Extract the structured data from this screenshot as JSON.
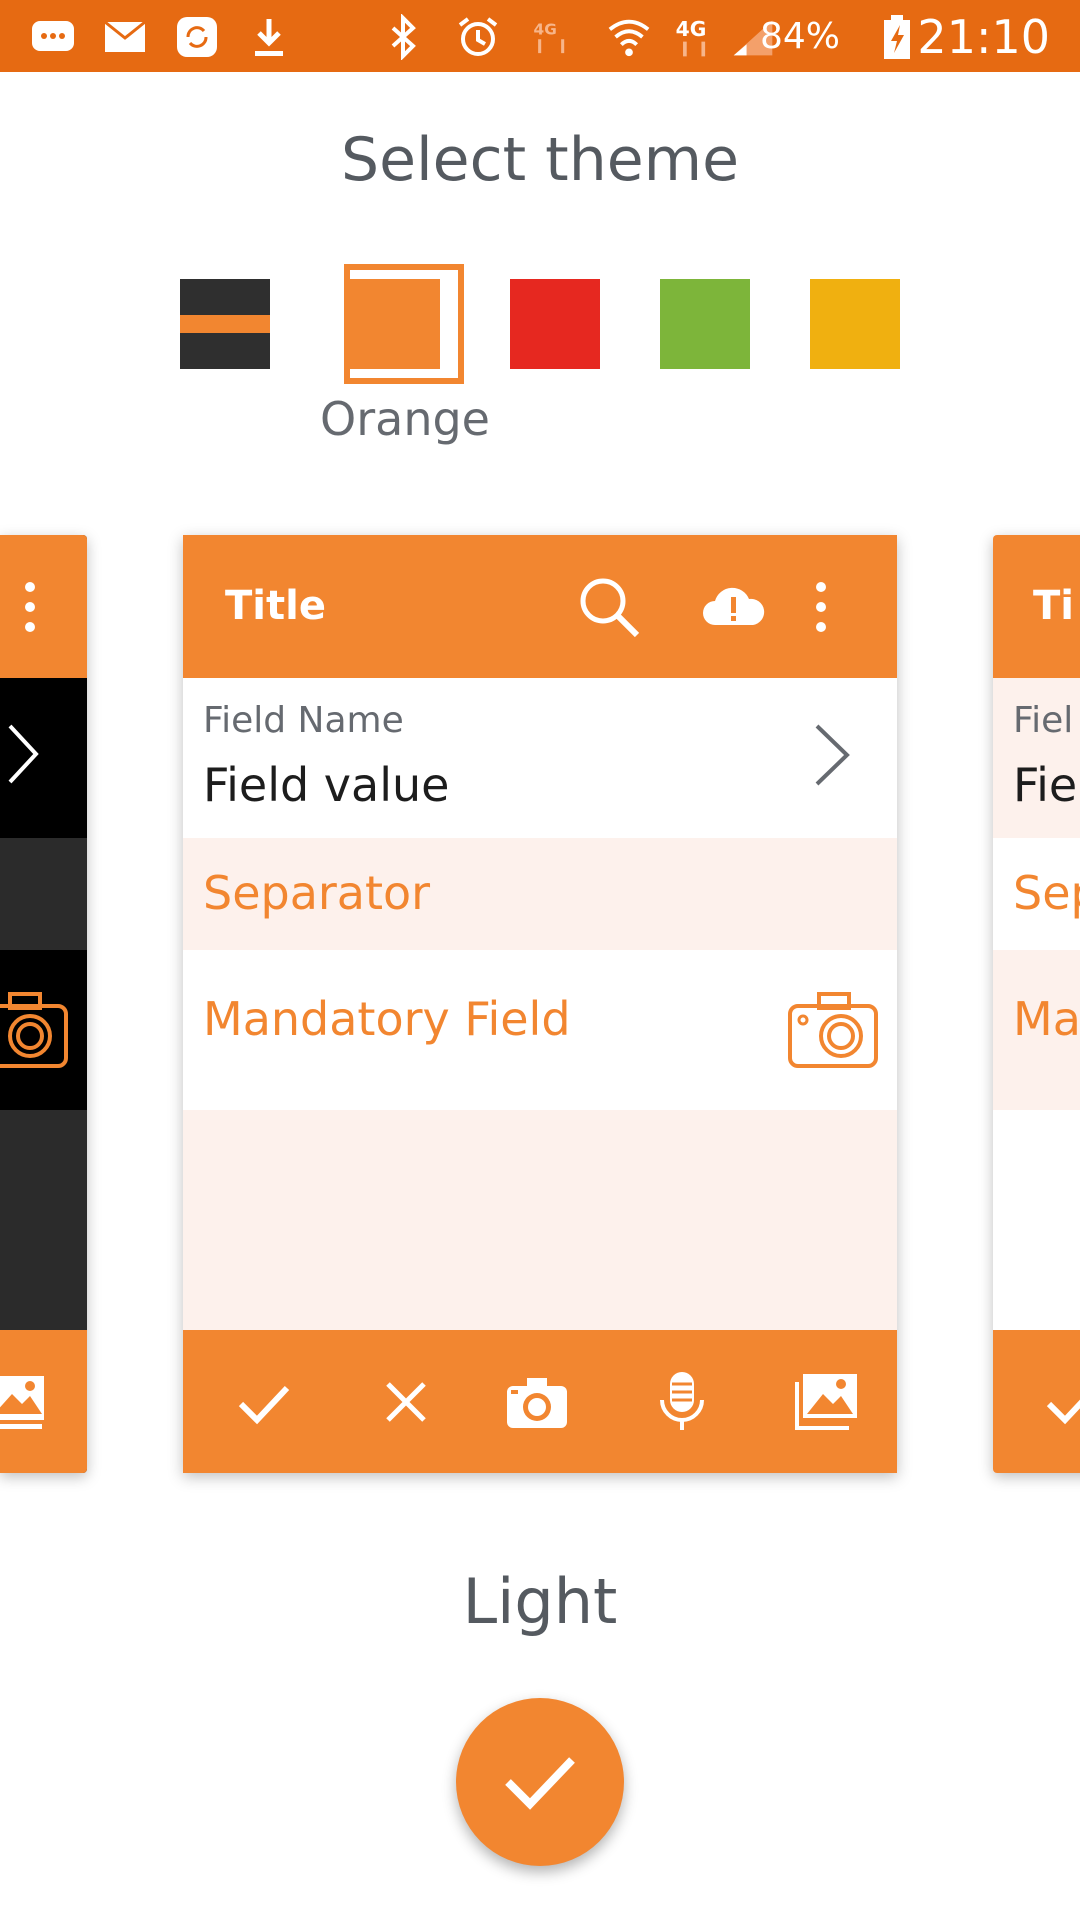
{
  "status_bar": {
    "battery": "84%",
    "time": "21:10",
    "network": "4G",
    "icons": [
      "messages-icon",
      "mail-icon",
      "sync-icon",
      "download-icon",
      "bluetooth-icon",
      "alarm-icon",
      "4g-data-icon",
      "wifi-icon",
      "4g-icon",
      "signal-icon",
      "battery-charging-icon"
    ]
  },
  "screen": {
    "title": "Select theme",
    "selected_color_label": "Orange",
    "variant_label": "Light"
  },
  "colors": {
    "accent": "#f28630",
    "status_bar": "#e66a12",
    "swatches": [
      {
        "name": "dark",
        "color": "#2f2f2f"
      },
      {
        "name": "orange",
        "color": "#f28630",
        "selected": true
      },
      {
        "name": "red",
        "color": "#e62820"
      },
      {
        "name": "green",
        "color": "#7db53a"
      },
      {
        "name": "yellow",
        "color": "#f0b010"
      }
    ]
  },
  "preview": {
    "title": "Title",
    "field_name": "Field Name",
    "field_value": "Field value",
    "separator": "Separator",
    "mandatory_field": "Mandatory Field",
    "header_icons": [
      "search-icon",
      "cloud-alert-icon",
      "more-vert-icon"
    ],
    "footer_icons": [
      "check-icon",
      "close-icon",
      "camera-icon",
      "microphone-icon",
      "gallery-icon"
    ]
  },
  "preview_right": {
    "title": "Ti",
    "field_name": "Fiel",
    "field_value": "Fie",
    "separator": "Sep",
    "mandatory_field": "Ma"
  }
}
